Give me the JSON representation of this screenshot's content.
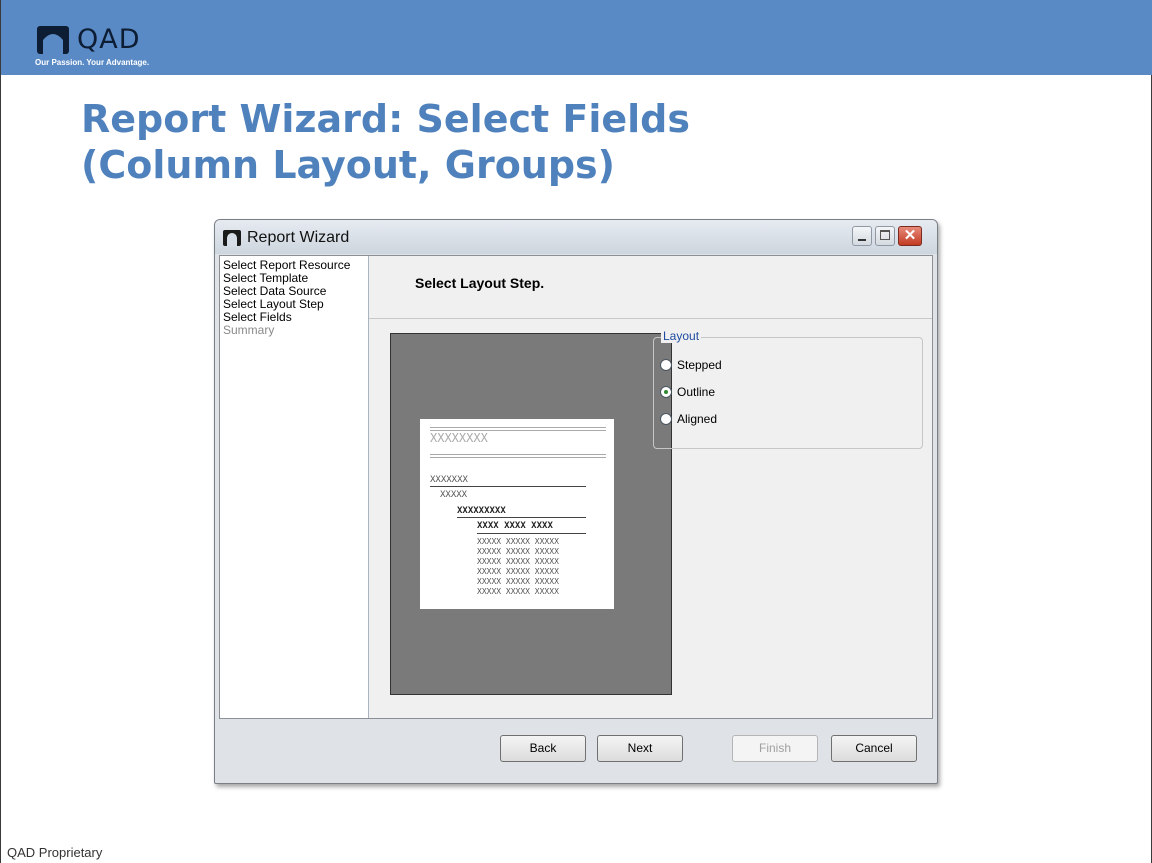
{
  "slide": {
    "logo_text": "QAD",
    "tagline": "Our Passion. Your Advantage.",
    "title_line1": "Report Wizard: Select Fields",
    "title_line2": "(Column Layout, Groups)",
    "footer": "QAD Proprietary"
  },
  "window": {
    "title": "Report Wizard",
    "close_glyph": "✕"
  },
  "steps": [
    {
      "label": "Select Report Resource",
      "enabled": true
    },
    {
      "label": "Select Template",
      "enabled": true
    },
    {
      "label": "Select Data Source",
      "enabled": true
    },
    {
      "label": "Select Layout Step",
      "enabled": true
    },
    {
      "label": "Select Fields",
      "enabled": true
    },
    {
      "label": "Summary",
      "enabled": false
    }
  ],
  "header": {
    "text": "Select Layout Step."
  },
  "preview": {
    "title_row": "XXXXXXXX",
    "group1": "XXXXXXX",
    "group2": "XXXXX",
    "group3": "XXXXXXXXX",
    "col_header": "XXXX  XXXX  XXXX",
    "data_row": "XXXXX XXXXX XXXXX"
  },
  "layout": {
    "legend": "Layout",
    "options": [
      {
        "label": "Stepped",
        "checked": false
      },
      {
        "label": "Outline",
        "checked": true
      },
      {
        "label": "Aligned",
        "checked": false
      }
    ]
  },
  "buttons": {
    "back": "Back",
    "next": "Next",
    "finish": "Finish",
    "cancel": "Cancel"
  },
  "colors": {
    "banner": "#5a8ac6",
    "title": "#4f81bd"
  },
  "icons": [
    "qad-logo-icon",
    "app-icon",
    "minimize-icon",
    "maximize-icon",
    "close-icon"
  ]
}
